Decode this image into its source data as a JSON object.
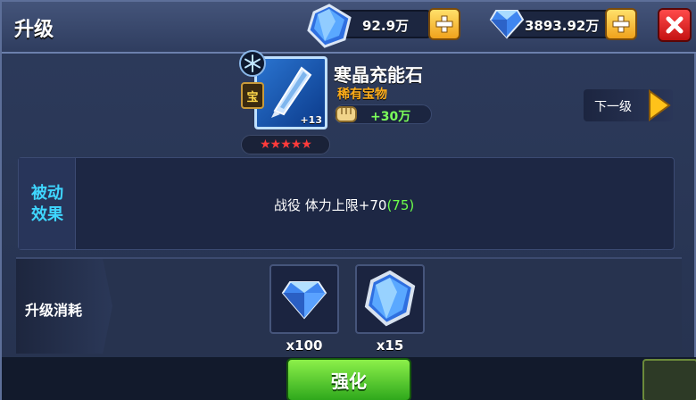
{
  "header": {
    "title": "升级",
    "currency_1_value": "92.9万",
    "currency_2_value": "3893.92万"
  },
  "item": {
    "name": "寒晶充能石",
    "rarity": "稀有宝物",
    "level_badge": "+13",
    "treasure_badge": "宝",
    "stars": "★★★★★",
    "power": "+30万",
    "rarity_color": "#ffae1a"
  },
  "next_level": {
    "label": "下一级"
  },
  "effect": {
    "tab_label": "被动效果",
    "text": "战役 体力上限+70",
    "bonus": "(75)",
    "tab_color": "#3fd6ff",
    "bonus_color": "#6cff4a"
  },
  "cost": {
    "label": "升级消耗",
    "items": [
      {
        "icon": "small-blue-gem-icon",
        "qty": "x100"
      },
      {
        "icon": "large-blue-gem-icon",
        "qty": "x15"
      }
    ]
  },
  "actions": {
    "upgrade_label": "强化"
  },
  "icons": {
    "close": "close-icon",
    "plus": "plus-icon",
    "frost": "snowflake-icon",
    "power": "fist-icon",
    "next": "chevron-right-icon"
  }
}
